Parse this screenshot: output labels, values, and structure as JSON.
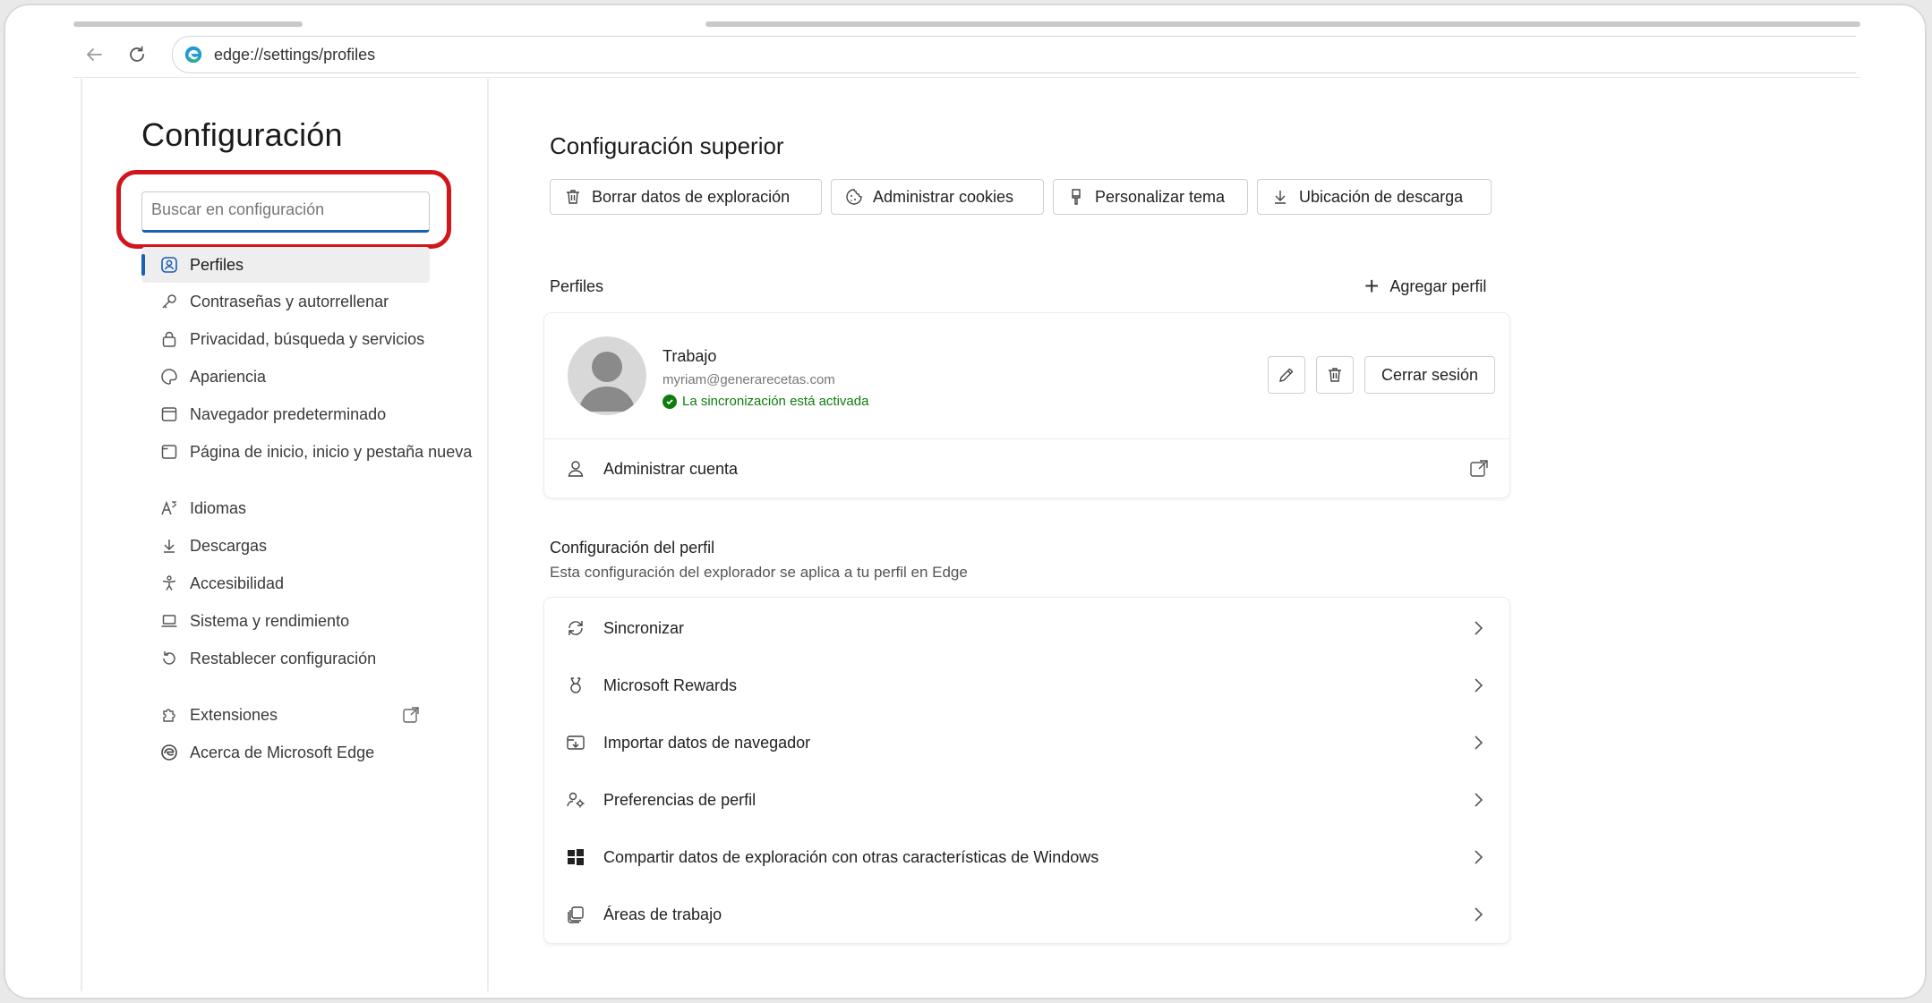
{
  "browser": {
    "address": "edge://settings/profiles"
  },
  "sidebar": {
    "title": "Configuración",
    "search_placeholder": "Buscar en configuración",
    "items": [
      {
        "label": "Perfiles",
        "icon": "profile-icon"
      },
      {
        "label": "Contraseñas y autorrellenar",
        "icon": "key-icon"
      },
      {
        "label": "Privacidad, búsqueda y servicios",
        "icon": "lock-icon"
      },
      {
        "label": "Apariencia",
        "icon": "palette-icon"
      },
      {
        "label": "Navegador predeterminado",
        "icon": "browser-icon"
      },
      {
        "label": "Página de inicio, inicio y pestaña nueva",
        "icon": "home-tab-icon"
      },
      {
        "label": "Idiomas",
        "icon": "language-icon"
      },
      {
        "label": "Descargas",
        "icon": "download-icon"
      },
      {
        "label": "Accesibilidad",
        "icon": "accessibility-icon"
      },
      {
        "label": "Sistema y rendimiento",
        "icon": "laptop-icon"
      },
      {
        "label": "Restablecer configuración",
        "icon": "reset-icon"
      },
      {
        "label": "Extensiones",
        "icon": "puzzle-icon"
      },
      {
        "label": "Acerca de Microsoft Edge",
        "icon": "edge-icon"
      }
    ]
  },
  "main": {
    "top_title": "Configuración superior",
    "quick_actions": [
      {
        "label": "Borrar datos de exploración",
        "icon": "trash-icon"
      },
      {
        "label": "Administrar cookies",
        "icon": "cookie-icon"
      },
      {
        "label": "Personalizar tema",
        "icon": "brush-icon"
      },
      {
        "label": "Ubicación de descarga",
        "icon": "download-icon"
      }
    ],
    "profiles_label": "Perfiles",
    "add_profile": "Agregar perfil",
    "profile": {
      "name": "Trabajo",
      "email": "myriam@generarecetas.com",
      "sync": "La sincronización está activada",
      "sign_out": "Cerrar sesión",
      "manage_account": "Administrar cuenta"
    },
    "profile_settings_title": "Configuración del perfil",
    "profile_settings_desc": "Esta configuración del explorador se aplica a tu perfil en Edge",
    "settings_rows": [
      {
        "label": "Sincronizar",
        "icon": "sync-icon"
      },
      {
        "label": "Microsoft Rewards",
        "icon": "rewards-icon"
      },
      {
        "label": "Importar datos de navegador",
        "icon": "import-icon"
      },
      {
        "label": "Preferencias de perfil",
        "icon": "profile-preferences-icon"
      },
      {
        "label": "Compartir datos de exploración con otras características de Windows",
        "icon": "windows-icon"
      },
      {
        "label": "Áreas de trabajo",
        "icon": "workspaces-icon"
      }
    ]
  },
  "colors": {
    "accent": "#1b5fb4",
    "highlight": "#d1151c",
    "sync_green": "#107c10"
  }
}
